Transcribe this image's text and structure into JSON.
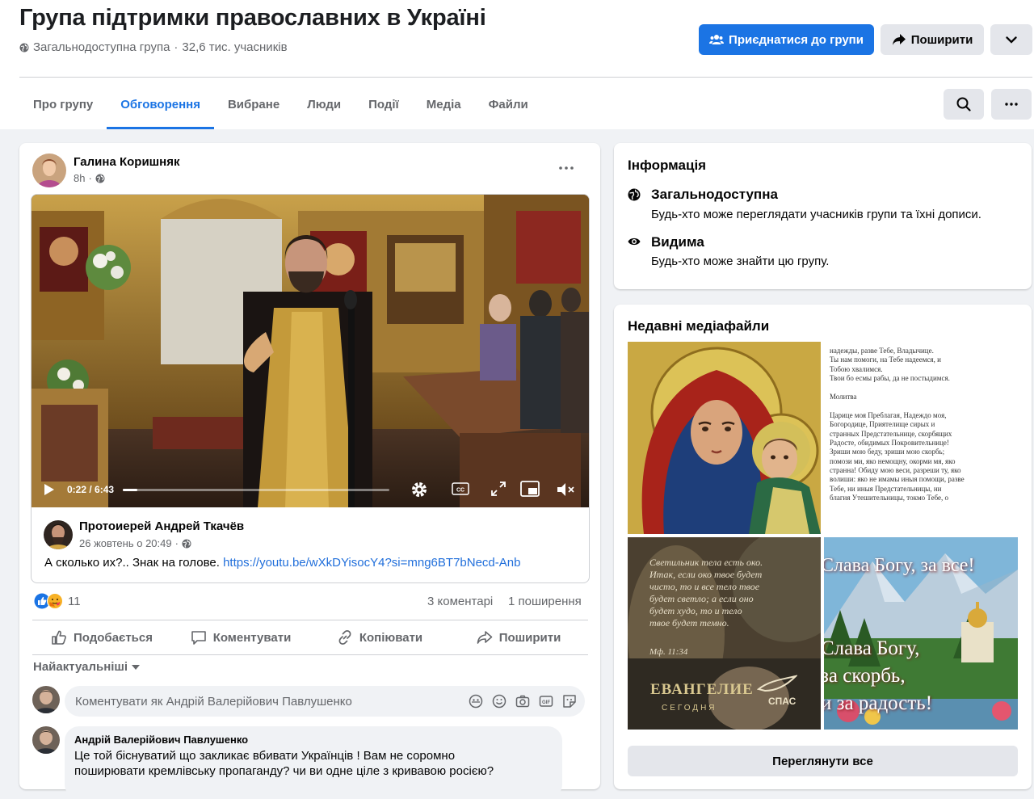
{
  "group": {
    "title": "Група підтримки православних в Україні",
    "privacy": "Загальнодоступна група",
    "members": "32,6 тис. учасників",
    "join_label": "Приєднатися до групи",
    "share_label": "Поширити"
  },
  "tabs": [
    {
      "label": "Про групу"
    },
    {
      "label": "Обговорення"
    },
    {
      "label": "Вибране"
    },
    {
      "label": "Люди"
    },
    {
      "label": "Події"
    },
    {
      "label": "Медіа"
    },
    {
      "label": "Файли"
    }
  ],
  "post": {
    "author": "Галина Коришняк",
    "time": "8h",
    "shared": {
      "video_time": "0:22 / 6:43",
      "video_progress": 0.055,
      "author": "Протоиерей Андрей Ткачёв",
      "date": "26 жовтень о 20:49",
      "text": "А сколько их?..  Знак на голове.",
      "link": "https://youtu.be/wXkDYisocY4?si=mng6BT7bNecd-Anb"
    },
    "reactions_count": "11",
    "comments_count": "3 коментарі",
    "shares_count": "1 поширення",
    "actions": {
      "like": "Подобається",
      "comment": "Коментувати",
      "copy": "Копіювати",
      "share": "Поширити"
    },
    "sort_label": "Найактуальніші",
    "comment_placeholder": "Коментувати як Андрій Валерійович Павлушенко",
    "comment": {
      "author": "Андрій Валерійович Павлушенко",
      "text1": "Це той біснуватий що закликає вбивати Українців ! Вам не соромно",
      "text2": "поширювати кремлівську пропаганду? чи ви одне ціле з кривавою росією?"
    }
  },
  "info": {
    "title": "Інформація",
    "public_title": "Загальнодоступна",
    "public_desc": "Будь-хто може переглядати учасників групи та їхні дописи.",
    "visible_title": "Видима",
    "visible_desc": "Будь-хто може знайти цю групу."
  },
  "media": {
    "title": "Недавні медіафайли",
    "see_all": "Переглянути все",
    "prayer_text": [
      "надежды, разве Тебе, Владычице.",
      "Ты нам помоги, на Тебе надеемся, и",
      "Тобою хвалимся.",
      "Твои бо есмы рабы, да не постыдимся.",
      "",
      "Молитва",
      "",
      "Царице моя Преблагая, Надеждо моя,",
      "Богородице, Приятелище сирых и",
      "странных Предстательнице, скорбящих",
      "Радосте, обидимых Покровительнице!",
      "Зриши мою беду, зриши мою скорбь;",
      "помози ми, яко немощну, окорми мя, яко",
      "странна! Обиду мою веси, разреши ту, яко",
      "волиши: яко не имамы иныя помощи, разве",
      "Тебе, ни иныя Предстательницы, ни",
      "благия Утешительницы, токмо Тебе, о"
    ],
    "verse_text": [
      "Светильник тела есть око.",
      "Итак, если око твое будет",
      "чисто, то и все тело твое",
      "будет светло; а если оно",
      "будет худо, то и тело",
      "твое будет темно."
    ],
    "verse_ref": "Мф. 11:34",
    "evangelie": "ЕВАНГЕЛИЕ",
    "segodnya": "СЕГОДНЯ",
    "spas": "СПАС",
    "glory_top": "Слава Богу, за все!",
    "glory_1": "Слава Богу,",
    "glory_2": "за скорбь,",
    "glory_3": "и за радость!"
  },
  "colors": {
    "accent": "#1b74e4",
    "link": "#216fdb",
    "secondary_text": "#65676b",
    "bg": "#f0f2f5"
  }
}
